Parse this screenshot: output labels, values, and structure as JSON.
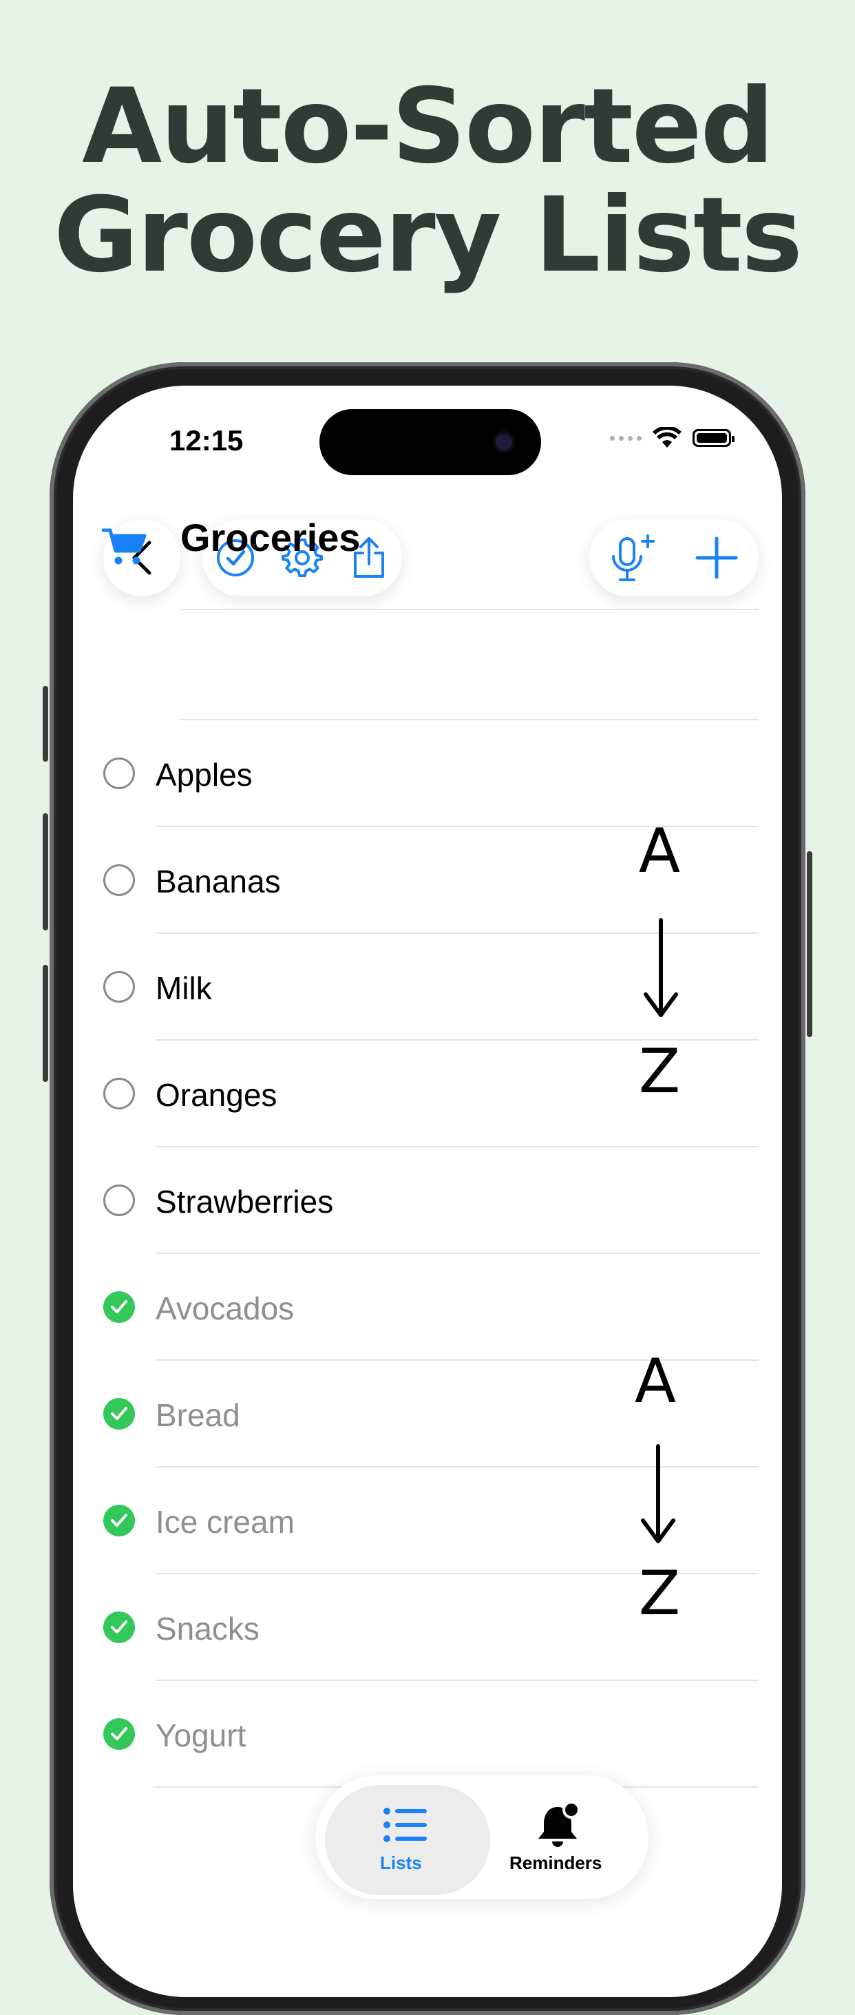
{
  "headline": {
    "line1": "Auto-Sorted",
    "line2": "Grocery Lists"
  },
  "status_bar": {
    "time": "12:15"
  },
  "toolbar": {
    "icons": [
      "back-chevron-icon",
      "checkmark-circle-icon",
      "gear-icon",
      "share-icon",
      "microphone-plus-icon",
      "plus-icon"
    ]
  },
  "list": {
    "title": "Groceries",
    "icon": "cart-icon",
    "unchecked_items": [
      "Apples",
      "Bananas",
      "Milk",
      "Oranges",
      "Strawberries"
    ],
    "checked_items": [
      "Avocados",
      "Bread",
      "Ice cream",
      "Snacks",
      "Yogurt"
    ]
  },
  "annotations": {
    "top": {
      "from": "A",
      "to": "Z"
    },
    "bottom": {
      "from": "A",
      "to": "Z"
    }
  },
  "tab_bar": {
    "tabs": [
      {
        "label": "Lists",
        "icon": "list-icon",
        "active": true
      },
      {
        "label": "Reminders",
        "icon": "bell-badge-icon",
        "active": false
      }
    ]
  },
  "colors": {
    "accent": "#1a82f7",
    "check": "#34c759",
    "background": "#e6f4e8",
    "headline": "#323a35"
  }
}
